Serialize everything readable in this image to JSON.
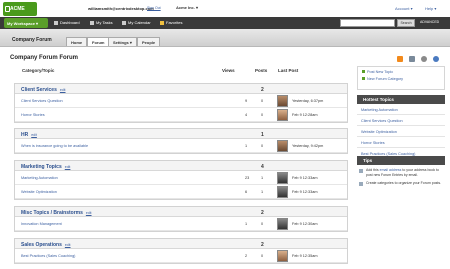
{
  "topbar": {
    "logo": "ACME",
    "user_email": "williamsmith@centrixdesktop.com",
    "signout": "Sign Out",
    "company": "Acme Inc.",
    "account": "Account",
    "help": "Help"
  },
  "nav": {
    "workspace": "My Workspace",
    "links": [
      "Dashboard",
      "My Tasks",
      "My Calendar",
      "Favorites"
    ],
    "search_button": "Search",
    "advanced": "ADVANCED"
  },
  "tabbar": {
    "section": "Company Forum",
    "tabs": [
      "Home",
      "Forum",
      "Settings",
      "People"
    ]
  },
  "forum": {
    "title": "Company Forum Forum",
    "headers": {
      "category": "Category/Topic",
      "views": "Views",
      "posts": "Posts",
      "last_post": "Last Post"
    },
    "edit": "edit",
    "groups": [
      {
        "title": "Client Services",
        "posts": "2",
        "rows": [
          {
            "name": "Client Services Question",
            "views": "9",
            "posts": "0",
            "date": "Yesterday, 6:37pm"
          },
          {
            "name": "Horror Stories",
            "views": "4",
            "posts": "0",
            "date": "Feb 9 12:28am"
          }
        ]
      },
      {
        "title": "HR",
        "posts": "1",
        "rows": [
          {
            "name": "When is insurance going to be available",
            "views": "1",
            "posts": "0",
            "date": "Yesterday, 9:42pm"
          }
        ]
      },
      {
        "title": "Marketing Topics",
        "posts": "4",
        "rows": [
          {
            "name": "Marketing Automation",
            "views": "23",
            "posts": "1",
            "date": "Feb 9 12:33am"
          },
          {
            "name": "Website Optimization",
            "views": "6",
            "posts": "1",
            "date": "Feb 9 12:33am"
          }
        ]
      },
      {
        "title": "Misc Topics / Brainstorms",
        "posts": "2",
        "rows": [
          {
            "name": "Innovation Management",
            "views": "1",
            "posts": "0",
            "date": "Feb 9 12:30am"
          }
        ]
      },
      {
        "title": "Sales Operations",
        "posts": "2",
        "rows": [
          {
            "name": "Best Practices (Sales Coaching)",
            "views": "2",
            "posts": "0",
            "date": "Feb 9 12:35am"
          }
        ]
      }
    ]
  },
  "sidebar": {
    "links": [
      "Post New Topic",
      "New Forum Category"
    ],
    "hot_title": "Hottest Topics",
    "hot_topics": [
      "Marketing Automation",
      "Client Services Question",
      "Website Optimization",
      "Horror Stories",
      "Best Practices (Sales Coaching)"
    ],
    "tips_title": "Tips",
    "tips": [
      {
        "pre": "Add this ",
        "link": "email address",
        "post": " to your address book to post new Forum Entries by email."
      },
      {
        "pre": "Create categories to organize your Forum posts.",
        "link": "",
        "post": ""
      }
    ]
  }
}
